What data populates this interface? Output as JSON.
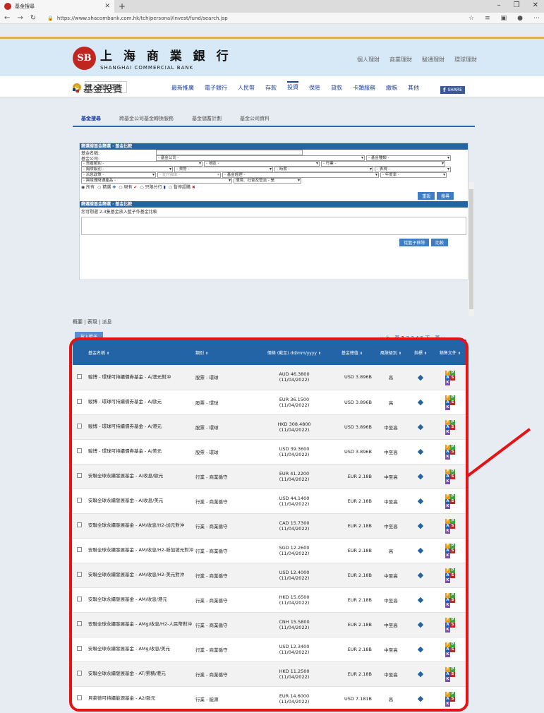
{
  "browser": {
    "tab_title": "基金搜尋",
    "url": "https://www.shacombank.com.hk/tch/personal/invest/fund/search.jsp"
  },
  "header": {
    "logo_emblem": "SB",
    "bank_cn": "上 海 商 業 銀 行",
    "bank_en": "SHANGHAI COMMERCIAL BANK",
    "topnav": [
      "個人理財",
      "商業理財",
      "駿通理財",
      "環球理財"
    ],
    "login": "登入網上理財",
    "menu": [
      "最新推廣",
      "電子銀行",
      "人民幣",
      "存款",
      "投資",
      "保險",
      "貸款",
      "卡類服務",
      "繳賬",
      "其他"
    ]
  },
  "page": {
    "title": "基金投資",
    "share": "SHARE",
    "tabs": [
      "基金搜尋",
      "跨基金公司基金轉換服務",
      "基金儲蓄計劃",
      "基金公司資料"
    ]
  },
  "filter": {
    "bar1": "篩選搜基金篩選 ‧ 基金比較",
    "fund_name_label": "基金名稱:",
    "company_label": "基金公司:",
    "company_sel": "- 基金公司 -",
    "fundtype_sel": "- 基金種類 -",
    "asset_sel": "- 資產類別 -",
    "region_sel": "- 地區 -",
    "industry_sel": "- 行業 -",
    "risk_sel": "- 風險級別 -",
    "currency_sel": "- 貨幣 -",
    "period_sel": "- 時期 -",
    "perf_sel": "- 表現 -",
    "dividend_sel": "- 派息政策 -",
    "freq_sel": "- 支付頻率 -",
    "manager_sel": "- 基金經理 -",
    "fee_sel": "- 年度率 -",
    "multi_sel": "- 跨境理財通產品 -",
    "esg_sel": "環境、社會及管治 - 是",
    "radios": [
      "所有",
      "精選",
      "現有",
      "只限分行",
      "暫停認購"
    ],
    "btn_reset": "重設",
    "btn_search": "搜尋",
    "bar2": "篩選搜基金篩選 ‧ 基金比較",
    "compare_hint": "您可剔選 2-3隻基金放入籃子作基金比較",
    "btn_remove": "從籃子移除",
    "btn_compare": "比較"
  },
  "results": {
    "views": "概要 | 表現 | 派息",
    "add_basket": "放入籃子",
    "pager": {
      "prev": "◂◂ 上一頁",
      "current": "1",
      "pages": [
        "2",
        "3",
        "4",
        "5"
      ],
      "next": "下一頁 ▸▸"
    },
    "headers": {
      "name": "基金名稱",
      "type": "類別",
      "price": "價格 (截至) dd/mm/yyyy",
      "size": "基金總值",
      "risk": "風險級別",
      "tag": "指標",
      "docs": "銷售文件"
    },
    "rows": [
      {
        "name": "駿博 - 環球可持續債券基金 - A/澳元對沖",
        "type": "股票 - 環球",
        "price": "AUD 46.3800",
        "date": "(11/04/2022)",
        "size": "USD 3.896B",
        "risk": "高"
      },
      {
        "name": "駿博 - 環球可持續債券基金 - A/歐元",
        "type": "股票 - 環球",
        "price": "EUR 36.1500",
        "date": "(11/04/2022)",
        "size": "USD 3.896B",
        "risk": "高"
      },
      {
        "name": "駿博 - 環球可持續債券基金 - A/港元",
        "type": "股票 - 環球",
        "price": "HKD 308.4800",
        "date": "(11/04/2022)",
        "size": "USD 3.896B",
        "risk": "中至高"
      },
      {
        "name": "駿博 - 環球可持續債券基金 - A/美元",
        "type": "股票 - 環球",
        "price": "USD 39.3600",
        "date": "(11/04/2022)",
        "size": "USD 3.896B",
        "risk": "中至高"
      },
      {
        "name": "安聯全球永續發展基金 - A/收息/歐元",
        "type": "行業 - 商業循守",
        "price": "EUR 41.2200",
        "date": "(11/04/2022)",
        "size": "EUR 2.18B",
        "risk": "中至高"
      },
      {
        "name": "安聯全球永續發展基金 - A/收息/美元",
        "type": "行業 - 商業循守",
        "price": "USD 44.1400",
        "date": "(11/04/2022)",
        "size": "EUR 2.18B",
        "risk": "中至高"
      },
      {
        "name": "安聯全球永續發展基金 - AM/收息/H2-加元對沖",
        "type": "行業 - 商業循守",
        "price": "CAD 15.7300",
        "date": "(11/04/2022)",
        "size": "EUR 2.18B",
        "risk": "中至高"
      },
      {
        "name": "安聯全球永續發展基金 - AM/收息/H2-新加坡元對沖",
        "type": "行業 - 商業循守",
        "price": "SGD 12.2600",
        "date": "(11/04/2022)",
        "size": "EUR 2.18B",
        "risk": "高"
      },
      {
        "name": "安聯全球永續發展基金 - AM/收息/H2-美元對沖",
        "type": "行業 - 商業循守",
        "price": "USD 12.4000",
        "date": "(11/04/2022)",
        "size": "EUR 2.18B",
        "risk": "中至高"
      },
      {
        "name": "安聯全球永續發展基金 - AM/收息/港元",
        "type": "行業 - 商業循守",
        "price": "HKD 15.6500",
        "date": "(11/04/2022)",
        "size": "EUR 2.18B",
        "risk": "中至高"
      },
      {
        "name": "安聯全球永續發展基金 - AMg/收息/H2-人民幣對沖",
        "type": "行業 - 商業循守",
        "price": "CNH 15.5800",
        "date": "(11/04/2022)",
        "size": "EUR 2.18B",
        "risk": "中至高"
      },
      {
        "name": "安聯全球永續發展基金 - AMg/收息/美元",
        "type": "行業 - 商業循守",
        "price": "USD 12.3400",
        "date": "(11/04/2022)",
        "size": "EUR 2.18B",
        "risk": "中至高"
      },
      {
        "name": "安聯全球永續發展基金 - AT/累積/港元",
        "type": "行業 - 商業循守",
        "price": "HKD 11.2500",
        "date": "(11/04/2022)",
        "size": "EUR 2.18B",
        "risk": "中至高"
      },
      {
        "name": "貝萊德可持續能源基金 - A2/歐元",
        "type": "行業 - 能源",
        "price": "EUR 14.6000",
        "date": "(11/04/2022)",
        "size": "USD 7.181B",
        "risk": "高"
      }
    ],
    "doc_letters": [
      "F",
      "P",
      "A",
      "S",
      "K"
    ],
    "doc_colors": [
      "#e89a1c",
      "#3aa33a",
      "#1f5fb3",
      "#c0261f",
      "#7b4fb0"
    ]
  }
}
